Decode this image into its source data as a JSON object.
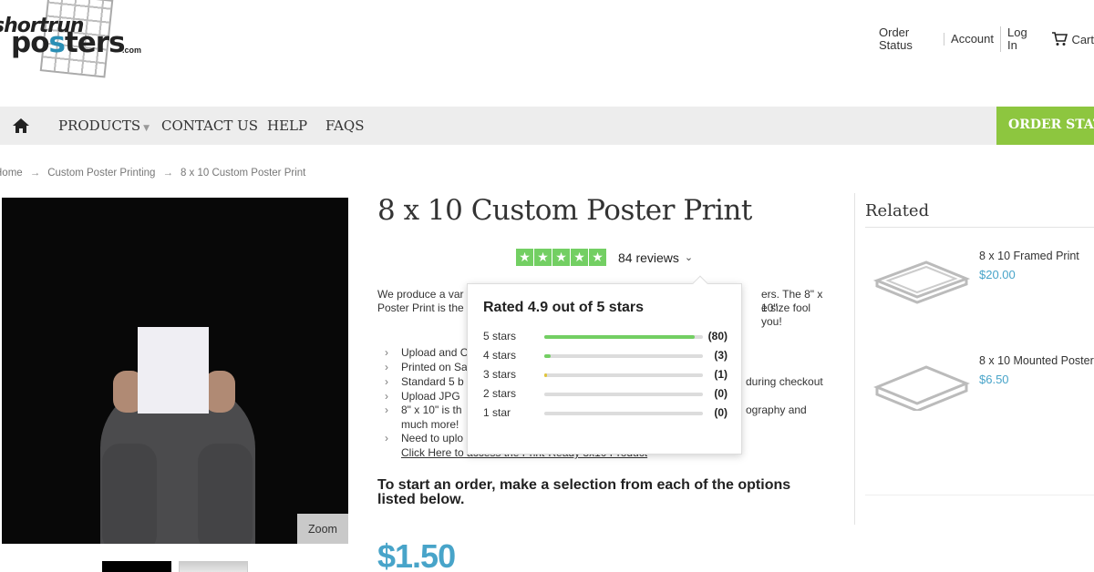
{
  "logo": {
    "line1": "shortrun",
    "line2_a": "po",
    "line2_b": "s",
    "line2_c": "ters",
    "suffix": ".com"
  },
  "top_links": {
    "order_status": "Order Status",
    "account": "Account",
    "login": "Log In",
    "cart": "Cart"
  },
  "nav": {
    "items": [
      {
        "label": "PRODUCTS",
        "has_dropdown": true
      },
      {
        "label": "CONTACT US"
      },
      {
        "label": "HELP"
      },
      {
        "label": "FAQS"
      }
    ],
    "order_status": "ORDER STATUS"
  },
  "breadcrumb": {
    "items": [
      "Home",
      "Custom Poster Printing",
      "8 x 10 Custom Poster Print"
    ],
    "separator": "→"
  },
  "product": {
    "title": "8 x 10 Custom Poster Print",
    "zoom_label": "Zoom",
    "rating_stars": 5,
    "reviews_label": "84 reviews",
    "desc_l1_a": "We produce a var",
    "desc_l1_b": "ers. The 8\" x 10\"",
    "desc_l2_a": "Poster Print is the",
    "desc_l2_b": "e size fool you!",
    "bullets": [
      {
        "a": "Upload and C",
        "b": ""
      },
      {
        "a": "Printed on Sa",
        "b": ""
      },
      {
        "a": "Standard 5 b",
        "b": "during checkout"
      },
      {
        "a": "Upload JPG",
        "b": ""
      },
      {
        "a": "8\" x 10\" is th",
        "b": "ography and"
      },
      {
        "a": "much more!",
        "b": ""
      },
      {
        "a": "Need to uplo",
        "b": ""
      },
      {
        "a": "Click Here to access the Print-Ready 8x10 Product",
        "b": ""
      }
    ],
    "start_text": "To start an order, make a selection from each of the options listed below.",
    "price": "$1.50"
  },
  "rating_popup": {
    "title": "Rated 4.9 out of 5 stars",
    "rows": [
      {
        "label": "5 stars",
        "count": "(80)",
        "fraction": 0.95,
        "color": "#73cf63"
      },
      {
        "label": "4 stars",
        "count": "(3)",
        "fraction": 0.04,
        "color": "#73cf63"
      },
      {
        "label": "3 stars",
        "count": "(1)",
        "fraction": 0.01,
        "color": "#e0c53c"
      },
      {
        "label": "2 stars",
        "count": "(0)",
        "fraction": 0,
        "color": "#f29b38"
      },
      {
        "label": "1 star",
        "count": "(0)",
        "fraction": 0,
        "color": "#e05a3c"
      }
    ]
  },
  "related": {
    "title": "Related",
    "items": [
      {
        "name": "8 x 10 Framed Print",
        "price": "$20.00",
        "icon": "framed-print-icon"
      },
      {
        "name": "8 x 10 Mounted Poster",
        "price": "$6.50",
        "icon": "mounted-poster-icon"
      }
    ]
  },
  "colors": {
    "accent_green": "#8dc63f",
    "price_blue": "#48a4c9",
    "trustpilot_green": "#73cf63",
    "nav_bg": "#ededed"
  }
}
